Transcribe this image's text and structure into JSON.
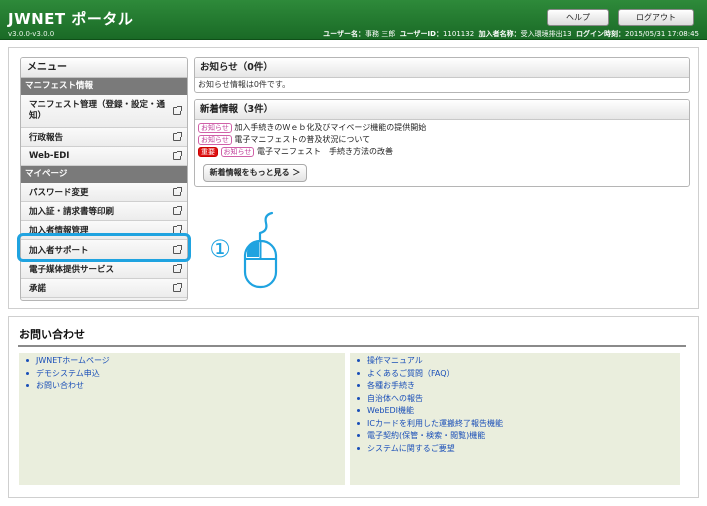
{
  "header": {
    "title": "JWNET ポータル",
    "version": "v3.0.0-v3.0.0",
    "help_label": "ヘルプ",
    "logout_label": "ログアウト",
    "user_name_label": "ユーザー名：",
    "user_name": "事務 三郎",
    "user_id_label": "ユーザーID：",
    "user_id": "1101132",
    "member_name_label": "加入者名称：",
    "member_name": "受入環境排出13",
    "login_time_label": "ログイン時刻：",
    "login_time": "2015/05/31 17:08:45"
  },
  "menu": {
    "title": "メニュー",
    "sections": [
      {
        "label": "マニフェスト情報",
        "items": [
          {
            "label": "マニフェスト管理（登録・設定・通知）"
          },
          {
            "label": "行政報告"
          },
          {
            "label": "Web-EDI"
          }
        ]
      },
      {
        "label": "マイページ",
        "items": [
          {
            "label": "パスワード変更"
          },
          {
            "label": "加入証・請求書等印刷"
          },
          {
            "label": "加入者情報管理"
          },
          {
            "label": "加入者サポート"
          },
          {
            "label": "電子媒体提供サービス"
          },
          {
            "label": "承諾"
          }
        ]
      }
    ]
  },
  "notice": {
    "title": "お知らせ（0件）",
    "body": "お知らせ情報は0件です。"
  },
  "news": {
    "title": "新着情報（3件）",
    "tag_label": "お知らせ",
    "important_label": "重要",
    "items": [
      {
        "text": "加入手続きのＷｅｂ化及びマイページ機能の提供開始"
      },
      {
        "text": "電子マニフェストの普及状況について"
      },
      {
        "text": "電子マニフェスト　手続き方法の改善"
      }
    ],
    "more_label": "新着情報をもっと見る ＞"
  },
  "annotation": {
    "step": "①"
  },
  "contact": {
    "title": "お問い合わせ",
    "left_links": [
      "JWNETホームページ",
      "デモシステム申込",
      "お問い合わせ"
    ],
    "right_links": [
      "操作マニュアル",
      "よくあるご質問（FAQ）",
      "各種お手続き",
      "自治体への報告",
      "WebEDI機能",
      "ICカードを利用した運搬終了報告機能",
      "電子契約(保管・検索・閲覧)機能",
      "システムに関するご要望"
    ]
  },
  "colors": {
    "header_green": "#1f7a2d",
    "highlight_blue": "#1fa3e0",
    "link_blue": "#1a4fb8",
    "tag_pink": "#c0409a",
    "important_red": "#d11111",
    "contact_bg": "#eaeedd"
  }
}
